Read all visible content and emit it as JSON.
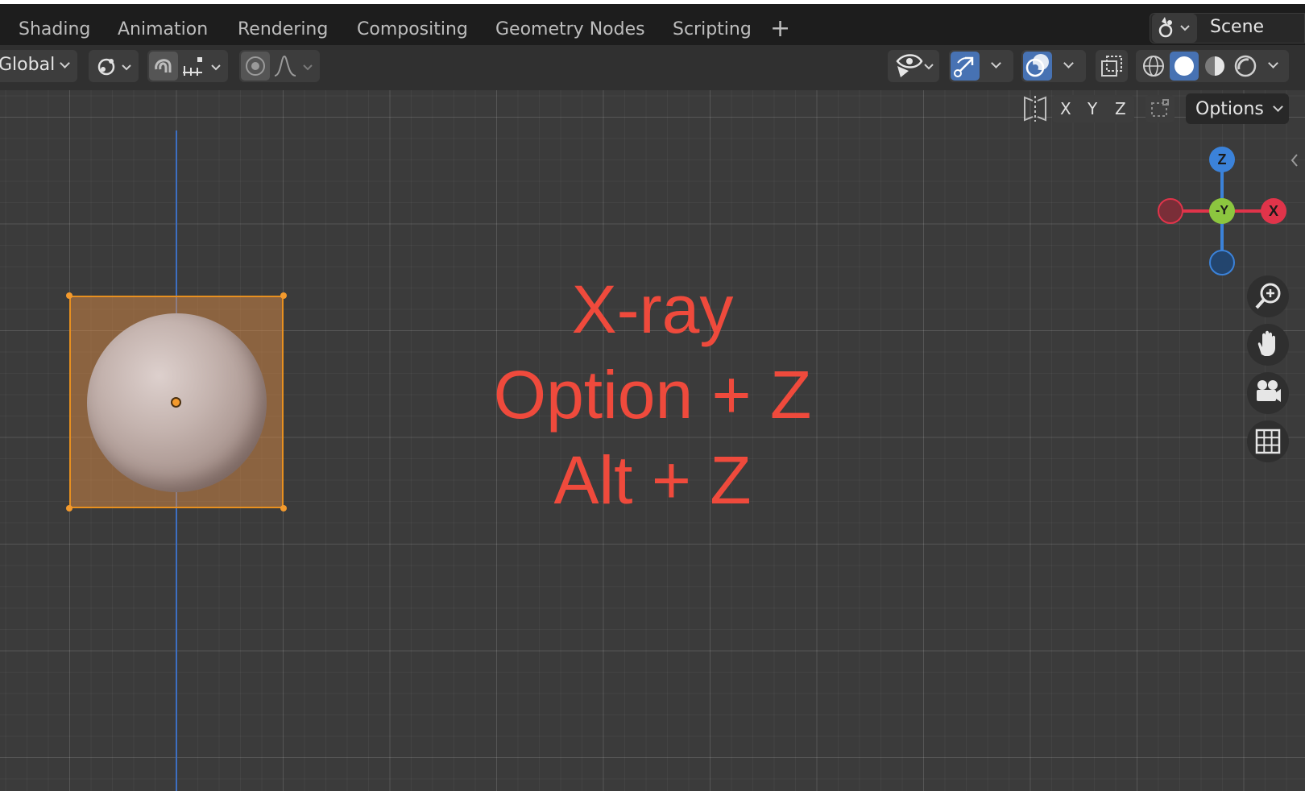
{
  "workspace_tabs": [
    "Shading",
    "Animation",
    "Rendering",
    "Compositing",
    "Geometry Nodes",
    "Scripting"
  ],
  "add_workspace": "+",
  "scene_name": "Scene",
  "toolbar": {
    "orientation": "Global",
    "options_label": "Options",
    "axis_x": "X",
    "axis_y": "Y",
    "axis_z": "Z"
  },
  "gizmo": {
    "z": "Z",
    "x": "X",
    "neg_y": "-Y"
  },
  "annotation": {
    "line1": "X-ray",
    "line2": "Option + Z",
    "line3": "Alt + Z"
  },
  "colors": {
    "accent_blue": "#4772b3",
    "annotation_red": "#ef4a3c",
    "selection_orange": "#e8901f",
    "axis_x_red": "#e0344a",
    "axis_y_green": "#8cc63f",
    "axis_z_blue": "#3b82d9"
  },
  "icons": [
    "transform-pivot-icon",
    "snap-icon",
    "proportional-edit-icon",
    "visibility-icon",
    "gizmo-icon",
    "overlay-icon",
    "xray-icon",
    "wireframe-shading-icon",
    "solid-shading-icon",
    "material-shading-icon",
    "rendered-shading-icon",
    "mirror-icon",
    "zoom-icon",
    "pan-hand-icon",
    "camera-icon",
    "grid-icon"
  ]
}
